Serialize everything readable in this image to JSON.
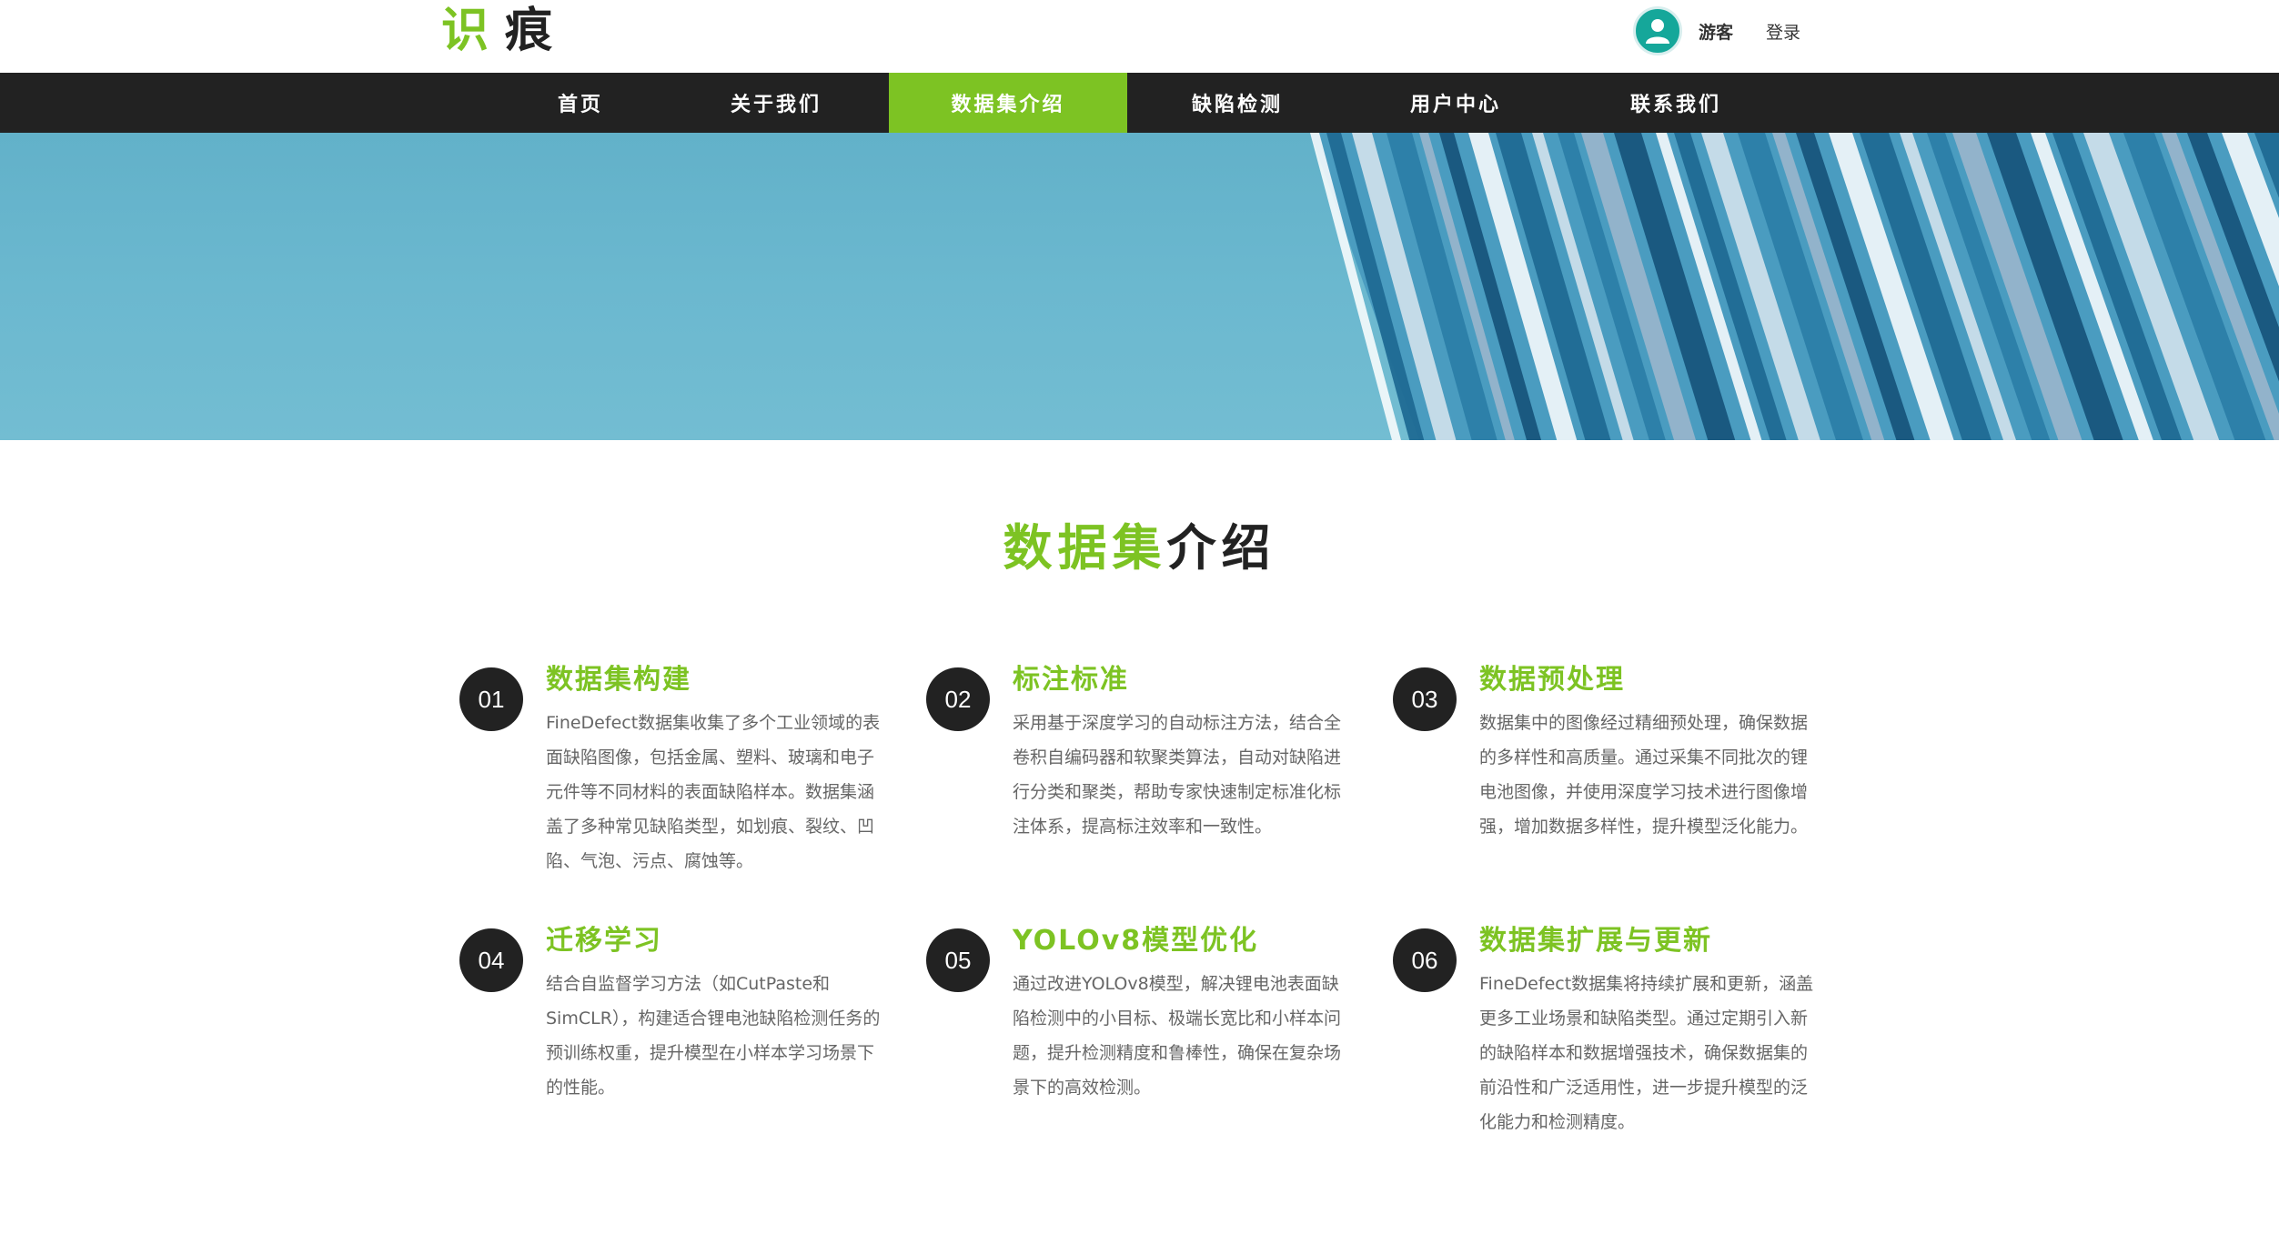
{
  "header": {
    "logo_part1": "识",
    "logo_part2": "痕",
    "user_name": "游客",
    "login_label": "登录"
  },
  "nav": {
    "items": [
      {
        "label": "首页"
      },
      {
        "label": "关于我们"
      },
      {
        "label": "数据集介绍",
        "active": true
      },
      {
        "label": "缺陷检测"
      },
      {
        "label": "用户中心"
      },
      {
        "label": "联系我们"
      }
    ]
  },
  "section": {
    "title_green": "数据集",
    "title_dark": "介绍"
  },
  "cards": [
    {
      "num": "01",
      "title": "数据集构建",
      "desc": "FineDefect数据集收集了多个工业领域的表面缺陷图像，包括金属、塑料、玻璃和电子元件等不同材料的表面缺陷样本。数据集涵盖了多种常见缺陷类型，如划痕、裂纹、凹陷、气泡、污点、腐蚀等。"
    },
    {
      "num": "02",
      "title": "标注标准",
      "desc": "采用基于深度学习的自动标注方法，结合全卷积自编码器和软聚类算法，自动对缺陷进行分类和聚类，帮助专家快速制定标准化标注体系，提高标注效率和一致性。"
    },
    {
      "num": "03",
      "title": "数据预处理",
      "desc": "数据集中的图像经过精细预处理，确保数据的多样性和高质量。通过采集不同批次的锂电池图像，并使用深度学习技术进行图像增强，增加数据多样性，提升模型泛化能力。"
    },
    {
      "num": "04",
      "title": "迁移学习",
      "desc": "结合自监督学习方法（如CutPaste和SimCLR），构建适合锂电池缺陷检测任务的预训练权重，提升模型在小样本学习场景下的性能。"
    },
    {
      "num": "05",
      "title": "YOLOv8模型优化",
      "desc": "通过改进YOLOv8模型，解决锂电池表面缺陷检测中的小目标、极端长宽比和小样本问题，提升检测精度和鲁棒性，确保在复杂场景下的高效检测。"
    },
    {
      "num": "06",
      "title": "数据集扩展与更新",
      "desc": "FineDefect数据集将持续扩展和更新，涵盖更多工业场景和缺陷类型。通过定期引入新的缺陷样本和数据增强技术，确保数据集的前沿性和广泛适用性，进一步提升模型的泛化能力和检测精度。"
    }
  ]
}
